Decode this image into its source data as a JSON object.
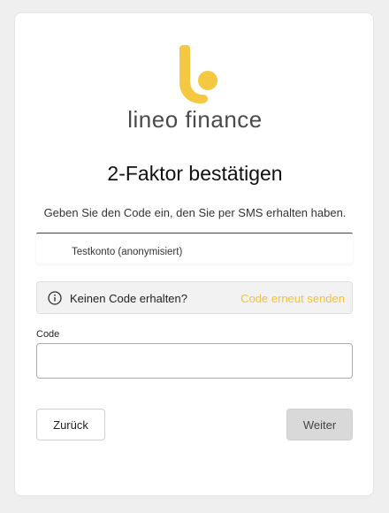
{
  "brand": {
    "name": "lineo finance",
    "accent_color": "#f5c842"
  },
  "page": {
    "title": "2-Faktor bestätigen",
    "subtitle": "Geben Sie den Code ein, den Sie per SMS erhalten haben."
  },
  "account": {
    "name": "Testkonto (anonymisiert)"
  },
  "notice": {
    "icon": "info-icon",
    "text": "Keinen Code erhalten?",
    "link": "Code erneut senden",
    "link_color": "#f2c232"
  },
  "code_field": {
    "label": "Code",
    "value": "",
    "placeholder": ""
  },
  "buttons": {
    "back_label": "Zurück",
    "next_label": "Weiter"
  }
}
